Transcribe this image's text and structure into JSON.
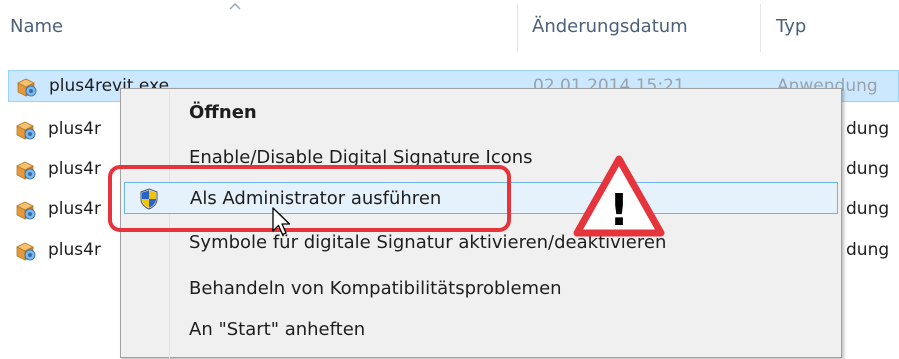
{
  "header": {
    "col_name": "Name",
    "col_date": "Änderungsdatum",
    "col_type": "Typ"
  },
  "files": [
    {
      "name": "plus4revit.exe",
      "date": "02.01.2014 15:21",
      "type": "Anwendung",
      "selected": true
    },
    {
      "name": "plus4r",
      "type": "dung"
    },
    {
      "name": "plus4r",
      "type": "dung"
    },
    {
      "name": "plus4r",
      "type": "dung"
    },
    {
      "name": "plus4r",
      "type": "dung"
    }
  ],
  "context_menu": {
    "items": [
      {
        "label": "Öffnen",
        "bold": true
      },
      {
        "label": "Enable/Disable Digital Signature Icons"
      },
      {
        "label": "Als Administrator ausführen",
        "icon": "uac-shield-icon",
        "hover": true
      },
      {
        "label": "Symbole für digitale Signatur aktivieren/deaktivieren"
      },
      {
        "label": "Behandeln von Kompatibilitätsproblemen"
      },
      {
        "label": "An \"Start\" anheften"
      }
    ]
  },
  "annotation": {
    "warning_glyph": "!",
    "highlight_color": "#e5343b"
  },
  "colors": {
    "selection_bg": "#cce8ff",
    "menu_hover_bg": "#e5f1fb",
    "header_text": "#4c607a"
  }
}
